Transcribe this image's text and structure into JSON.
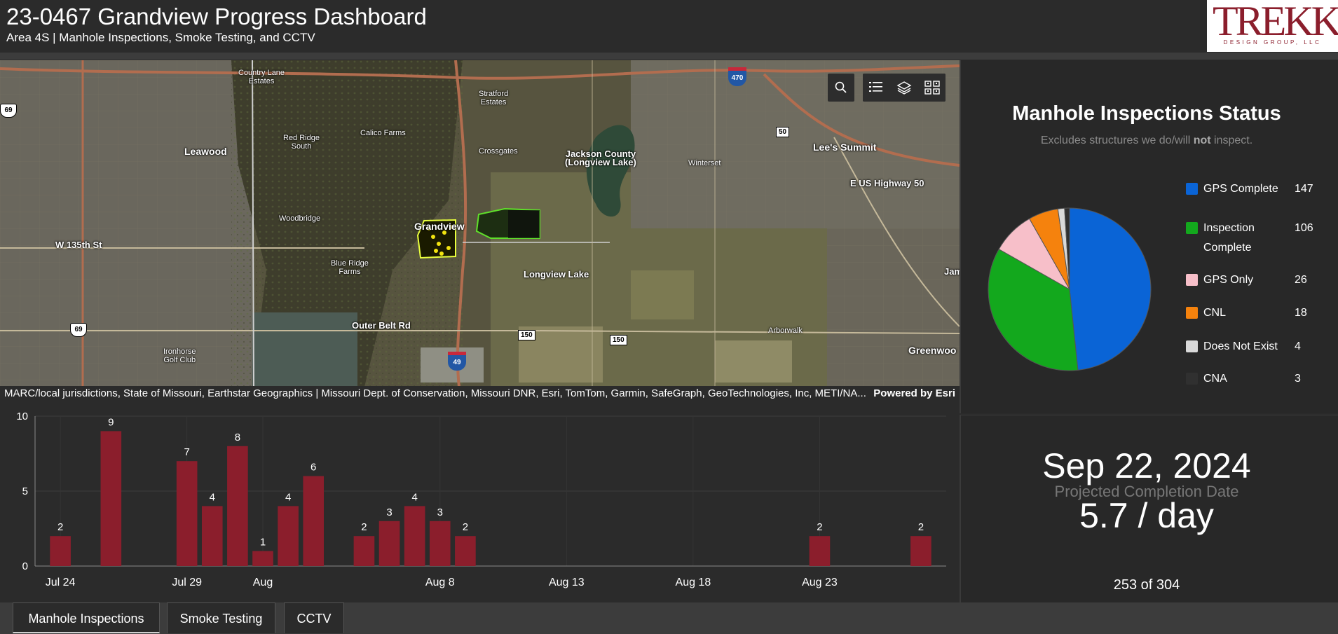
{
  "header": {
    "title": "23-0467 Grandview Progress Dashboard",
    "subtitle": "Area 4S | Manhole Inspections, Smoke Testing, and CCTV",
    "logo_text": "TREKK",
    "logo_subtext": "DESIGN GROUP, LLC"
  },
  "map": {
    "labels": {
      "leawood": "Leawood",
      "country_lane": "Country Lane\nEstates",
      "red_ridge": "Red Ridge\nSouth",
      "calico_farms": "Calico Farms",
      "stratford": "Stratford\nEstates",
      "crossgates": "Crossgates",
      "jackson_county": "Jackson County\n(Longview Lake)",
      "winterset": "Winterset",
      "lees_summit": "Lee's Summit",
      "us_highway_50": "E US Highway 50",
      "woodbridge": "Woodbridge",
      "grandview": "Grandview",
      "w135": "W 135th St",
      "blue_ridge": "Blue Ridge\nFarms",
      "longview_lake": "Longview Lake",
      "jam": "Jam",
      "outer_belt": "Outer Belt Rd",
      "arborwalk": "Arborwalk",
      "ironhorse": "Ironhorse\nGolf Club",
      "greenwood": "Greenwoo"
    },
    "shields": {
      "i470": "470",
      "i49": "49",
      "us69_top": "69",
      "us69_bottom": "69",
      "us50": "50",
      "rt150_a": "150",
      "rt150_b": "150"
    },
    "tools": [
      "search-icon",
      "list-icon",
      "layers-icon",
      "qr-grid-icon"
    ],
    "attribution": "MARC/local jurisdictions, State of Missouri, Earthstar Geographics | Missouri Dept. of Conservation, Missouri DNR, Esri, TomTom, Garmin, SafeGraph, GeoTechnologies, Inc, METI/NA...",
    "powered_by": "Powered by Esri"
  },
  "pie": {
    "title": "Manhole Inspections Status",
    "subtitle_pre": "Excludes structures we do/will ",
    "subtitle_bold": "not",
    "subtitle_post": " inspect."
  },
  "stats": {
    "projected_date": "Sep 22, 2024",
    "projected_label": "Projected Completion Date",
    "rate": "5.7 / day",
    "count": "253 of 304"
  },
  "tabs": [
    {
      "label": "Manhole Inspections",
      "active": true
    },
    {
      "label": "Smoke Testing",
      "active": false
    },
    {
      "label": "CCTV",
      "active": false
    }
  ],
  "chart_data": [
    {
      "type": "pie",
      "title": "Manhole Inspections Status",
      "categories": [
        "GPS Complete",
        "Inspection Complete",
        "GPS Only",
        "CNL",
        "Does Not Exist",
        "CNA"
      ],
      "values": [
        147,
        106,
        26,
        18,
        4,
        3
      ],
      "colors": [
        "#0a64d6",
        "#13a81d",
        "#f7bfc9",
        "#f5820d",
        "#d9d9d9",
        "#303030"
      ],
      "legend": "right"
    },
    {
      "type": "bar",
      "color": "#8b1e2c",
      "ylim": [
        0,
        10
      ],
      "yticks": [
        0,
        5,
        10
      ],
      "xticks": [
        "Jul 24",
        "Jul 29",
        "Aug",
        "Aug 8",
        "Aug 13",
        "Aug 18",
        "Aug 23"
      ],
      "x": [
        "2024-07-24",
        "2024-07-26",
        "2024-07-29",
        "2024-07-30",
        "2024-07-31",
        "2024-08-01",
        "2024-08-02",
        "2024-08-03",
        "2024-08-05",
        "2024-08-06",
        "2024-08-07",
        "2024-08-08",
        "2024-08-09",
        "2024-08-23",
        "2024-08-27"
      ],
      "values": [
        2,
        9,
        7,
        4,
        8,
        1,
        4,
        6,
        2,
        3,
        4,
        3,
        2,
        2,
        2
      ],
      "grid": true
    }
  ]
}
